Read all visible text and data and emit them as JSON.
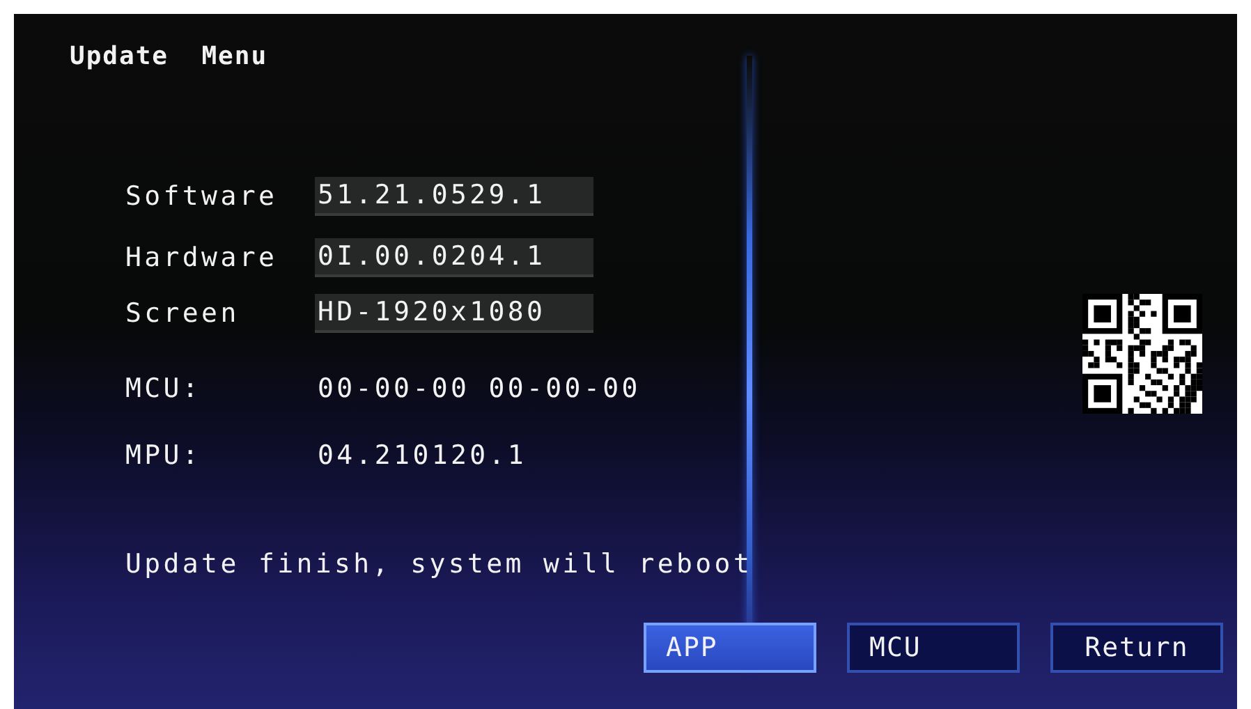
{
  "title": "Update  Menu",
  "fields": [
    {
      "label": "Software",
      "value": "51.21.0529.1",
      "kind": "boxed"
    },
    {
      "label": "Hardware",
      "value": "0I.00.0204.1",
      "kind": "boxed"
    },
    {
      "label": "Screen",
      "value": "HD-1920x1080",
      "kind": "boxed"
    },
    {
      "label": "MCU:",
      "value": "00-00-00 00-00-00",
      "kind": "plain"
    },
    {
      "label": "MPU:",
      "value": "04.210120.1",
      "kind": "plain"
    }
  ],
  "message": "Update finish, system will reboot",
  "buttons": [
    {
      "label": "APP",
      "selected": true
    },
    {
      "label": "MCU",
      "selected": false
    },
    {
      "label": "Return",
      "selected": false
    }
  ]
}
